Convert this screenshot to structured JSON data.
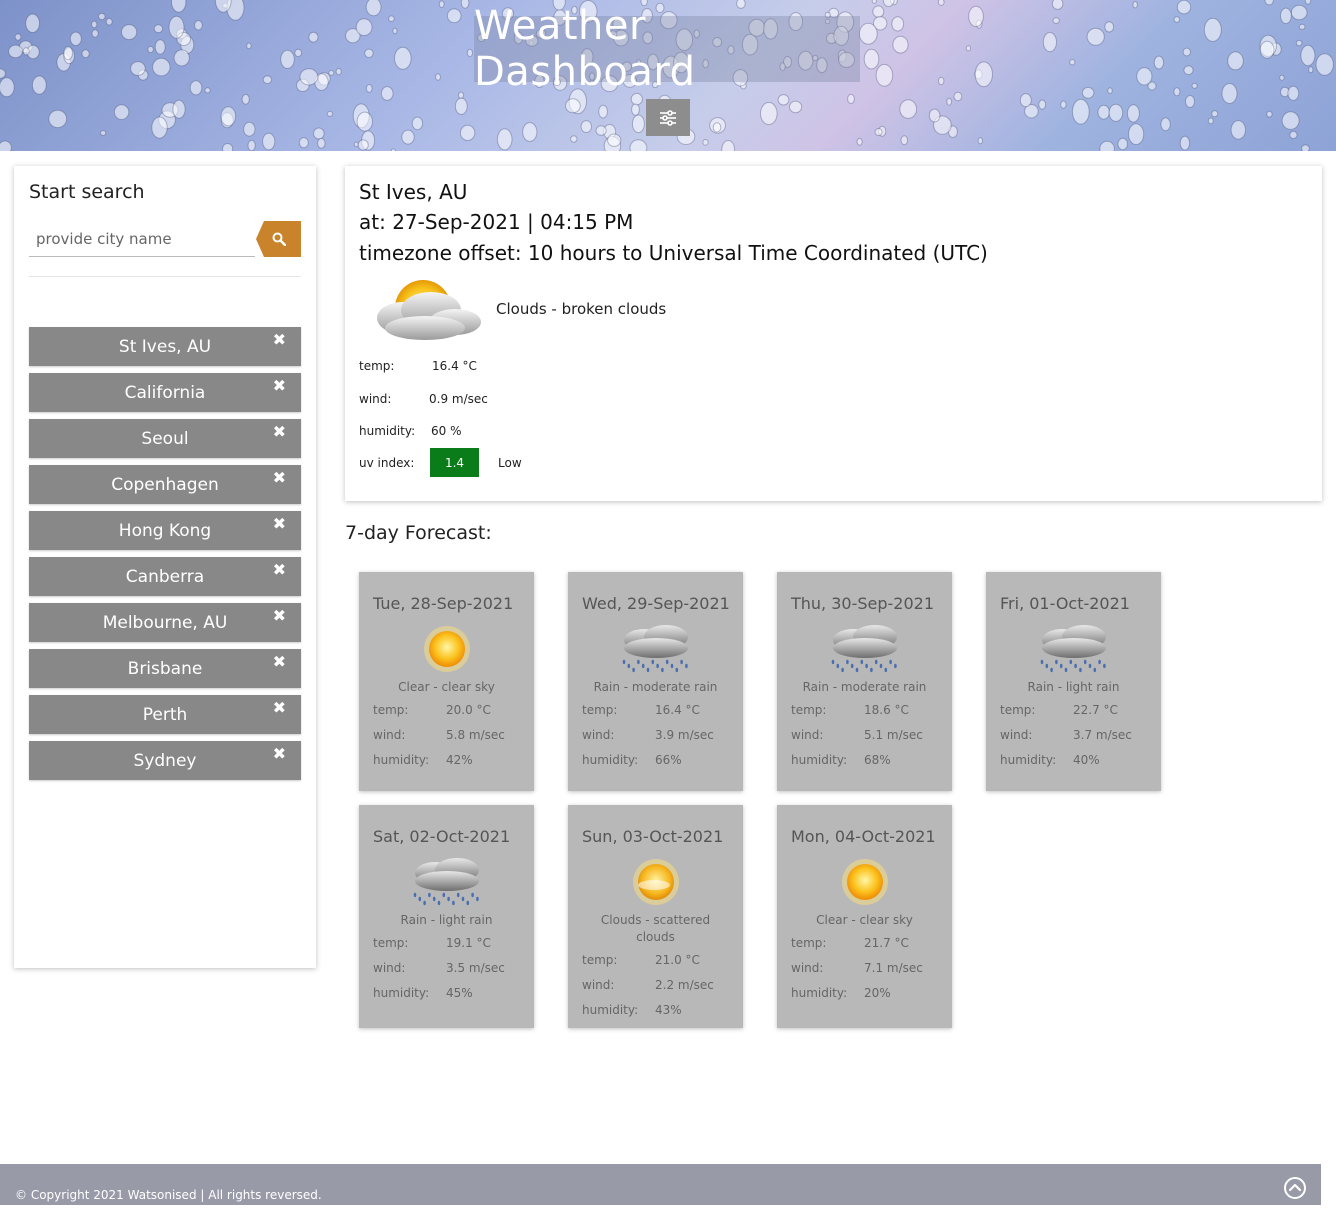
{
  "header": {
    "title": "Weather Dashboard",
    "settings_icon": "sliders-icon"
  },
  "sidebar": {
    "title": "Start search",
    "search_placeholder": "provide city name",
    "search_icon": "search-icon",
    "cities": [
      "St Ives, AU",
      "California",
      "Seoul",
      "Copenhagen",
      "Hong Kong",
      "Canberra",
      "Melbourne, AU",
      "Brisbane",
      "Perth",
      "Sydney"
    ],
    "remove_glyph": "✖"
  },
  "current": {
    "city": "St Ives, AU",
    "at": "at: 27-Sep-2021 | 04:15 PM",
    "timezone": "timezone offset: 10 hours to Universal Time Coordinated (UTC)",
    "icon": "broken-clouds-icon",
    "description": "Clouds - broken clouds",
    "labels": {
      "temp": "temp:",
      "wind": "wind:",
      "humidity": "humidity:",
      "uv": "uv index:"
    },
    "temp": "16.4 °C",
    "wind": "0.9 m/sec",
    "humidity": "60 %",
    "uv_index": "1.4",
    "uv_level": "Low",
    "uv_color": "#0a7d1a"
  },
  "forecast": {
    "title": "7-day Forecast:",
    "labels": {
      "temp": "temp:",
      "wind": "wind:",
      "humidity": "humidity:"
    },
    "days": [
      {
        "date": "Tue, 28-Sep-2021",
        "icon": "sun-icon",
        "desc": "Clear - clear sky",
        "temp": "20.0 °C",
        "wind": "5.8 m/sec",
        "humidity": "42%"
      },
      {
        "date": "Wed, 29-Sep-2021",
        "icon": "rain-icon",
        "desc": "Rain - moderate rain",
        "temp": "16.4 °C",
        "wind": "3.9 m/sec",
        "humidity": "66%"
      },
      {
        "date": "Thu, 30-Sep-2021",
        "icon": "rain-icon",
        "desc": "Rain - moderate rain",
        "temp": "18.6 °C",
        "wind": "5.1 m/sec",
        "humidity": "68%"
      },
      {
        "date": "Fri, 01-Oct-2021",
        "icon": "rain-icon",
        "desc": "Rain - light rain",
        "temp": "22.7 °C",
        "wind": "3.7 m/sec",
        "humidity": "40%"
      },
      {
        "date": "Sat, 02-Oct-2021",
        "icon": "rain-icon",
        "desc": "Rain - light rain",
        "temp": "19.1 °C",
        "wind": "3.5 m/sec",
        "humidity": "45%"
      },
      {
        "date": "Sun, 03-Oct-2021",
        "icon": "scattered-clouds-icon",
        "desc": "Clouds - scattered clouds",
        "temp": "21.0 °C",
        "wind": "2.2 m/sec",
        "humidity": "43%"
      },
      {
        "date": "Mon, 04-Oct-2021",
        "icon": "sun-icon",
        "desc": "Clear - clear sky",
        "temp": "21.7 °C",
        "wind": "7.1 m/sec",
        "humidity": "20%"
      }
    ]
  },
  "footer": {
    "copyright": "© Copyright 2021 Watsonised | All rights reversed.",
    "back_to_top_icon": "chevron-up-circle-icon"
  }
}
